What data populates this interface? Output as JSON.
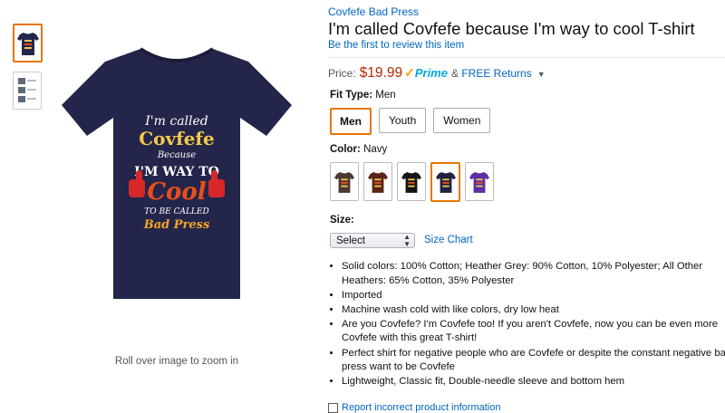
{
  "gallery": {
    "thumbnails": [
      {
        "name": "thumbnail-front",
        "selected": true
      },
      {
        "name": "thumbnail-detail",
        "selected": false
      }
    ],
    "zoom_hint": "Roll over image to zoom in",
    "shirt_print": {
      "line1": "I'm called",
      "line2": "Covfefe",
      "line3": "Because",
      "line4": "I'M WAY TO",
      "line5": "Cool",
      "line6": "TO BE CALLED",
      "line7": "Bad Press"
    }
  },
  "product": {
    "brand": "Covfefe Bad Press",
    "title": "I'm called Covfefe because I'm way to cool T-shirt",
    "review_link": "Be the first to review this item",
    "price_label": "Price:",
    "price": "$19.99",
    "prime_check": "✓",
    "prime_word": "Prime",
    "returns_prefix": "&",
    "returns_link": "FREE Returns",
    "returns_caret": "▼"
  },
  "fit_type": {
    "label": "Fit Type:",
    "selected": "Men",
    "options": [
      "Men",
      "Youth",
      "Women"
    ]
  },
  "color": {
    "label": "Color:",
    "selected": "Navy",
    "swatches": [
      {
        "color": "#4a3a33"
      },
      {
        "color": "#5a2418"
      },
      {
        "color": "#151515"
      },
      {
        "color": "#1f2240"
      },
      {
        "color": "#5a2fa6"
      }
    ]
  },
  "size": {
    "label": "Size:",
    "select_value": "Select",
    "size_chart": "Size Chart"
  },
  "bullets": [
    "Solid colors: 100% Cotton; Heather Grey: 90% Cotton, 10% Polyester; All Other Heathers: 65% Cotton, 35% Polyester",
    "Imported",
    "Machine wash cold with like colors, dry low heat",
    "Are you Covfefe? I'm Covfefe too! If you aren't Covfefe, now you can be even more Covfefe with this great T-shirt!",
    "Perfect shirt for negative people who are Covfefe or despite the constant negative bad press want to be Covfefe",
    "Lightweight, Classic fit, Double-needle sleeve and bottom hem"
  ],
  "bottom_link": "Report incorrect product information",
  "colors": {
    "link": "#0066c0",
    "price": "#b12704",
    "selected_border": "#e77600",
    "shirt_navy": "#23264a"
  }
}
